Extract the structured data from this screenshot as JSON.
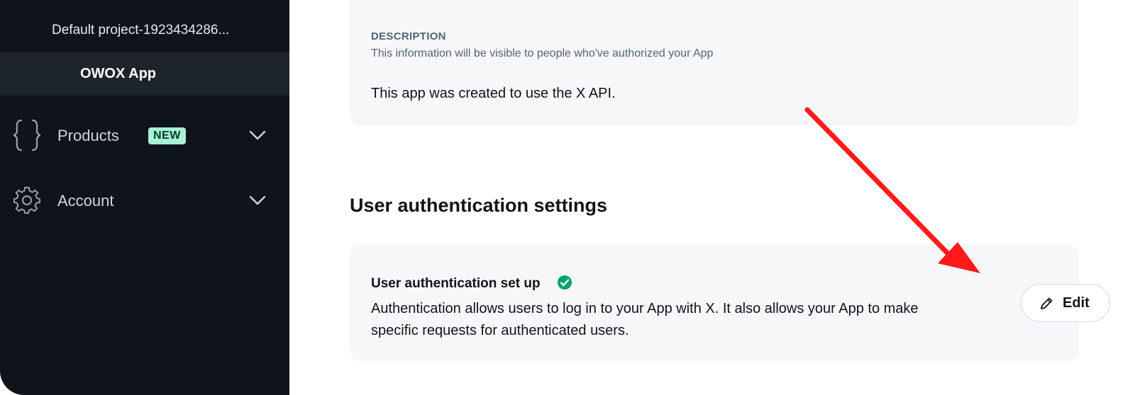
{
  "sidebar": {
    "project_name": "Default project-1923434286...",
    "app_name": "OWOX App",
    "items": [
      {
        "label": "Products",
        "badge": "NEW",
        "icon": "curly-braces-icon"
      },
      {
        "label": "Account",
        "badge": "",
        "icon": "gear-icon"
      }
    ]
  },
  "description": {
    "label": "DESCRIPTION",
    "sublabel": "This information will be visible to people who've authorized your App",
    "value": "This app was created to use the X API."
  },
  "auth": {
    "section_title": "User authentication settings",
    "title": "User authentication set up",
    "status_icon": "check-circle-icon",
    "description": "Authentication allows users to log in to your App with X. It also allows your App to make specific requests for authenticated users.",
    "edit_label": "Edit"
  },
  "colors": {
    "sidebar_bg": "#0f141a",
    "card_bg": "#f7f7f9",
    "badge_bg": "#a7f0d4",
    "success": "#00a36c",
    "annotation_arrow": "#ff1a1a"
  }
}
